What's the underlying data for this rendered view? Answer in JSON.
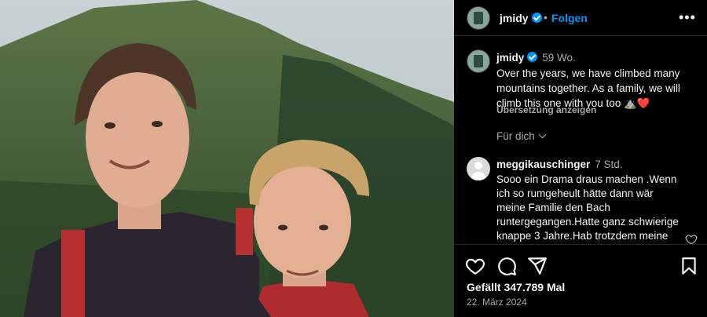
{
  "post": {
    "image_alt": "Family photo of a young woman and a boy in the mountains",
    "author": "jmidy",
    "follow_label": "Folgen",
    "more_label": "•••",
    "separator": "•"
  },
  "caption": {
    "username": "jmidy",
    "time": "59 Wo.",
    "text": "Over the years, we have climbed many mountains together. As a family, we will climb this one with you too ⛰️❤️",
    "translate_label": "Übersetzung anzeigen"
  },
  "sort": {
    "label": "Für dich"
  },
  "comment": {
    "username": "meggikauschinger",
    "time": "7 Std.",
    "text": "Sooo ein Drama draus machen .Wenn ich so rumgeheult hätte dann wär meine Familie den Bach runtergegangen.Hatte ganz schwierige knappe 3 Jahre.Hab trotzdem meine Familie"
  },
  "footer": {
    "likes": "Gefällt 347.789 Mal",
    "date": "22. März 2024"
  },
  "icons": [
    "verified-badge-icon",
    "heart-icon",
    "comment-icon",
    "share-icon",
    "bookmark-icon",
    "chevron-down-icon",
    "more-icon"
  ],
  "colors": {
    "accent": "#0095f6",
    "background": "#000000",
    "muted": "#a8a8a8",
    "like_red": "#ed4956"
  }
}
